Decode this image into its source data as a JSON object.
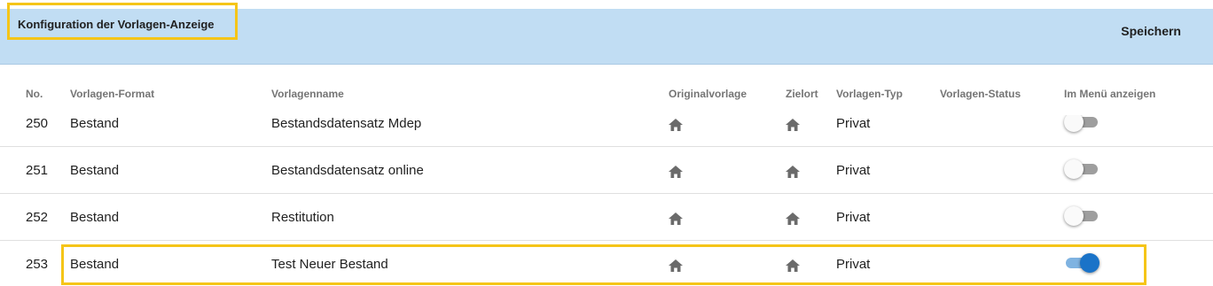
{
  "header": {
    "title": "Konfiguration der Vorlagen-Anzeige",
    "save_label": "Speichern"
  },
  "columns": [
    "No.",
    "Vorlagen-Format",
    "Vorlagenname",
    "Originalvorlage",
    "Zielort",
    "Vorlagen-Typ",
    "Vorlagen-Status",
    "Im Menü anzeigen"
  ],
  "rows": [
    {
      "no": "250",
      "format": "Bestand",
      "name": "Bestandsdatensatz Mdep",
      "original_icon": "home-icon",
      "target_icon": "home-icon",
      "type": "Privat",
      "status": "",
      "show_in_menu": false
    },
    {
      "no": "251",
      "format": "Bestand",
      "name": "Bestandsdatensatz online",
      "original_icon": "home-icon",
      "target_icon": "home-icon",
      "type": "Privat",
      "status": "",
      "show_in_menu": false
    },
    {
      "no": "252",
      "format": "Bestand",
      "name": "Restitution",
      "original_icon": "home-icon",
      "target_icon": "home-icon",
      "type": "Privat",
      "status": "",
      "show_in_menu": false
    },
    {
      "no": "253",
      "format": "Bestand",
      "name": "Test Neuer Bestand",
      "original_icon": "home-icon",
      "target_icon": "home-icon",
      "type": "Privat",
      "status": "",
      "show_in_menu": true
    }
  ],
  "colors": {
    "header_bg": "#c1ddf3",
    "highlight": "#f5c518",
    "toggle_on": "#1a73c8",
    "icon": "#6b6b6b"
  }
}
